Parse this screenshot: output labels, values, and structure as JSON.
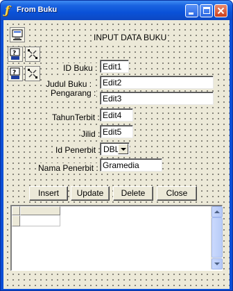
{
  "window": {
    "title": "From Buku",
    "app_icon": "delphi-icon",
    "controls": {
      "minimize": "minimize-icon",
      "maximize": "maximize-icon",
      "close": "close-icon"
    }
  },
  "form": {
    "heading": "INPUT DATA BUKU",
    "fields": [
      {
        "label": "ID Buku",
        "value": "Edit1"
      },
      {
        "label": "Judul Buku",
        "value": "Edit2"
      },
      {
        "label": "Pengarang",
        "value": "Edit3"
      },
      {
        "label": "TahunTerbit",
        "value": "Edit4"
      },
      {
        "label": "Jilid",
        "value": "Edit5"
      },
      {
        "label": "Id Penerbit",
        "value": "DBL"
      },
      {
        "label": "Nama Penerbit",
        "value": "Gramedia"
      }
    ],
    "buttons": {
      "insert": "Insert",
      "update": "Update",
      "delete": "Delete",
      "close": "Close"
    }
  },
  "components": [
    "database-component-icon",
    "query-component-icon",
    "navigator-component-icon",
    "query-component-icon",
    "navigator-component-icon"
  ],
  "colors": {
    "titlebar": "#0a52d8",
    "form_bg": "#ece9d8",
    "close_button": "#cd3f1b"
  }
}
